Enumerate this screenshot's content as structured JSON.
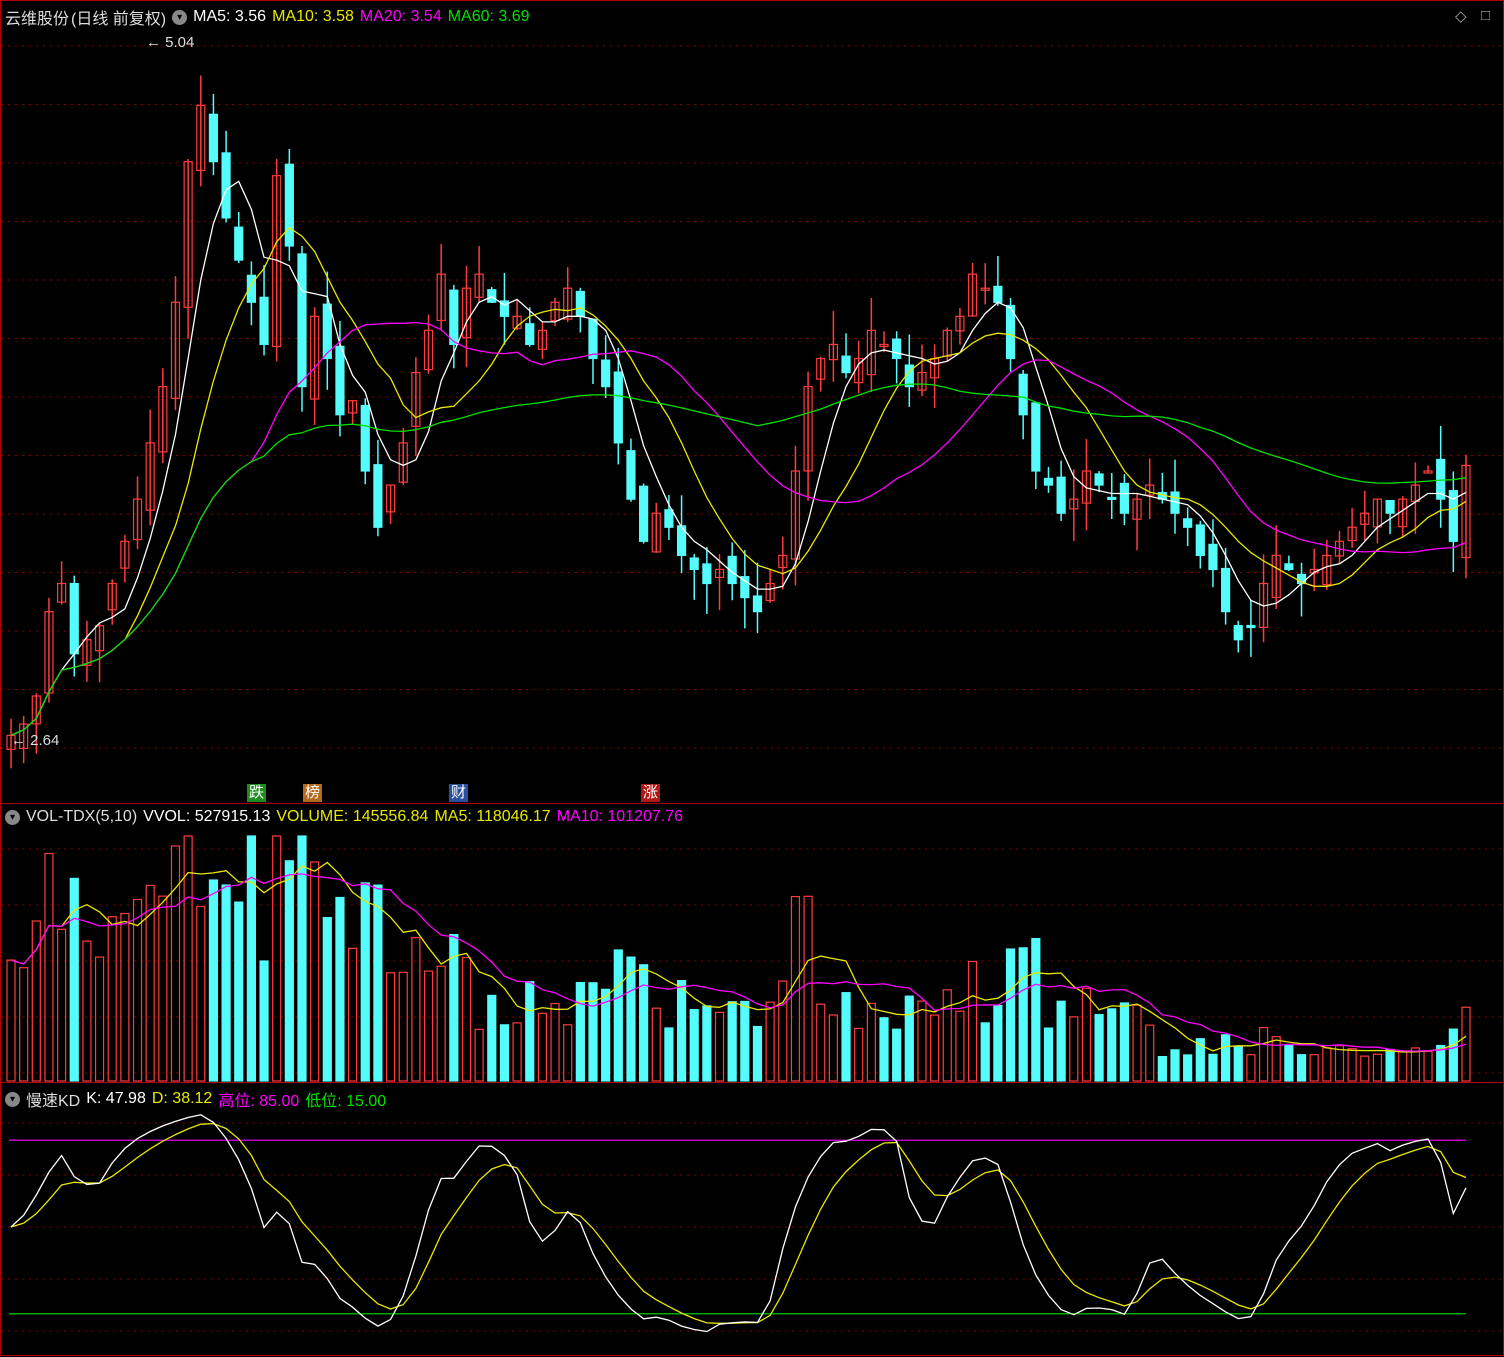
{
  "stock": {
    "name": "云维股份",
    "period": "(日线 前复权)",
    "ma5": "MA5: 3.56",
    "ma10": "MA10: 3.58",
    "ma20": "MA20: 3.54",
    "ma60": "MA60: 3.69",
    "high_label": "5.04",
    "low_label": "2.64"
  },
  "events": [
    {
      "label": "跌",
      "color": "#1e8c1e"
    },
    {
      "label": "榜",
      "color": "#b36a1e"
    },
    {
      "label": "财",
      "color": "#2a4f9e"
    },
    {
      "label": "涨",
      "color": "#b01818"
    }
  ],
  "volume": {
    "indicator": "VOL-TDX(5,10)",
    "vvol": "VVOL: 527915.13",
    "volume": "VOLUME: 145556.84",
    "ma5": "MA5: 118046.17",
    "ma10": "MA10: 101207.76"
  },
  "kd": {
    "name": "慢速KD",
    "k": "K: 47.98",
    "d": "D: 38.12",
    "high": "高位: 85.00",
    "low": "低位: 15.00"
  },
  "colors": {
    "up": "#ff3c3c",
    "down": "#54fcfc",
    "ma5": "#ffffff",
    "ma10": "#e8e800",
    "ma20": "#ff00ff",
    "ma60": "#00e000",
    "grid": "#8a0000"
  },
  "chart_data": {
    "type": "candlestick",
    "price_range": [
      2.64,
      5.04
    ],
    "close_series": [
      2.66,
      2.7,
      2.8,
      3.1,
      3.2,
      2.95,
      3.0,
      3.05,
      3.2,
      3.35,
      3.5,
      3.7,
      3.9,
      4.2,
      4.7,
      4.9,
      4.7,
      4.5,
      4.35,
      4.2,
      4.05,
      4.65,
      4.4,
      3.9,
      4.15,
      4.0,
      3.8,
      3.85,
      3.6,
      3.4,
      3.55,
      3.7,
      3.95,
      4.1,
      4.3,
      4.05,
      4.25,
      4.3,
      4.2,
      4.15,
      4.15,
      4.05,
      4.1,
      4.2,
      4.25,
      4.15,
      4.0,
      3.9,
      3.7,
      3.5,
      3.35,
      3.45,
      3.4,
      3.3,
      3.25,
      3.2,
      3.25,
      3.2,
      3.15,
      3.1,
      3.2,
      3.3,
      3.6,
      3.9,
      4.0,
      4.05,
      3.95,
      4.0,
      4.1,
      4.05,
      4.0,
      3.9,
      3.95,
      4.0,
      4.1,
      4.15,
      4.3,
      4.25,
      4.2,
      4.0,
      3.8,
      3.6,
      3.55,
      3.45,
      3.5,
      3.6,
      3.55,
      3.5,
      3.45,
      3.5,
      3.55,
      3.5,
      3.45,
      3.4,
      3.3,
      3.25,
      3.1,
      3.0,
      3.05,
      3.2,
      3.3,
      3.25,
      3.2,
      3.25,
      3.3,
      3.35,
      3.4,
      3.45,
      3.5,
      3.45,
      3.5,
      3.55,
      3.6,
      3.5,
      3.35,
      3.62
    ],
    "kd_levels": {
      "high": 85,
      "low": 15,
      "k": 47.98,
      "d": 38.12
    }
  }
}
